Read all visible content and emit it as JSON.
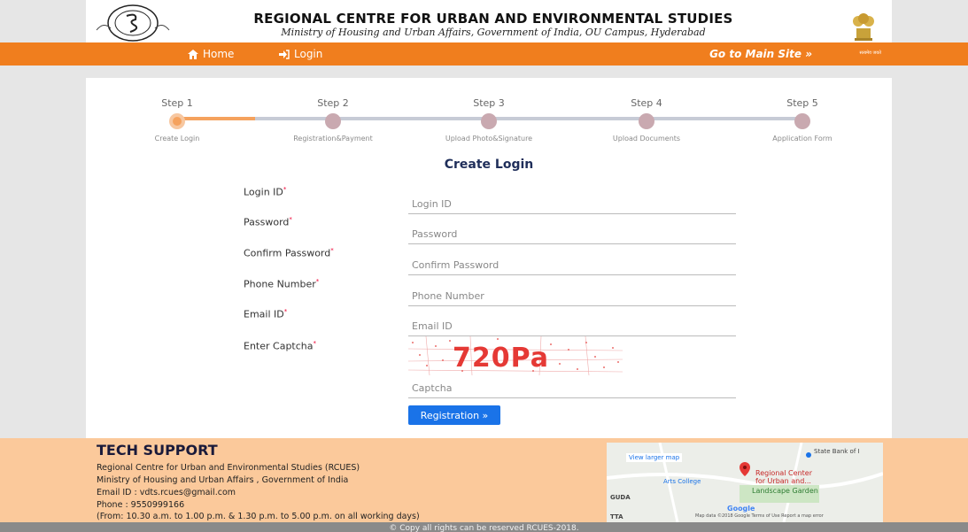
{
  "header": {
    "title": "REGIONAL CENTRE FOR URBAN AND ENVIRONMENTAL STUDIES",
    "subtitle": "Ministry of Housing and Urban Affairs, Government of India, OU Campus, Hyderabad"
  },
  "nav": {
    "home": "Home",
    "login": "Login",
    "main_site": "Go to Main Site »",
    "emblem_caption": "सत्यमेव जयते"
  },
  "steps": [
    {
      "title": "Step 1",
      "sub": "Create Login",
      "active": true
    },
    {
      "title": "Step 2",
      "sub": "Registration&Payment",
      "active": false
    },
    {
      "title": "Step 3",
      "sub": "Upload Photo&Signature",
      "active": false
    },
    {
      "title": "Step 4",
      "sub": "Upload Documents",
      "active": false
    },
    {
      "title": "Step 5",
      "sub": "Application Form",
      "active": false
    }
  ],
  "form": {
    "title": "Create Login",
    "fields": [
      {
        "label": "Login ID",
        "placeholder": "Login ID"
      },
      {
        "label": "Password",
        "placeholder": "Password"
      },
      {
        "label": "Confirm Password",
        "placeholder": "Confirm Password"
      },
      {
        "label": "Phone Number",
        "placeholder": "Phone Number"
      },
      {
        "label": "Email ID",
        "placeholder": "Email ID"
      },
      {
        "label": "Enter Captcha",
        "placeholder": "Captcha"
      }
    ],
    "required_mark": "*",
    "captcha_text": "720Pa",
    "submit": "Registration »"
  },
  "footer": {
    "title": "TECH SUPPORT",
    "lines": [
      "Regional Centre for Urban and Environmental Studies (RCUES)",
      "Ministry of Housing and Urban Affairs , Government of India",
      "Email ID : vdts.rcues@gmail.com",
      "Phone : 9550999166",
      "(From: 10.30 a.m. to 1.00 p.m. & 1.30 p.m. to 5.00 p.m. on all working days)"
    ],
    "map": {
      "link": "View larger map",
      "pin_label": "Regional Center for Urban and...",
      "arts_college": "Arts College",
      "landscape": "Landscape Garden",
      "bank": "State Bank of I",
      "guda": "GUDA",
      "tta": "TTA",
      "google": "Google",
      "attribution": "Map data ©2018 Google   Terms of Use   Report a map error"
    }
  },
  "copyright": "© Copy all rights can be reserved RCUES-2018."
}
